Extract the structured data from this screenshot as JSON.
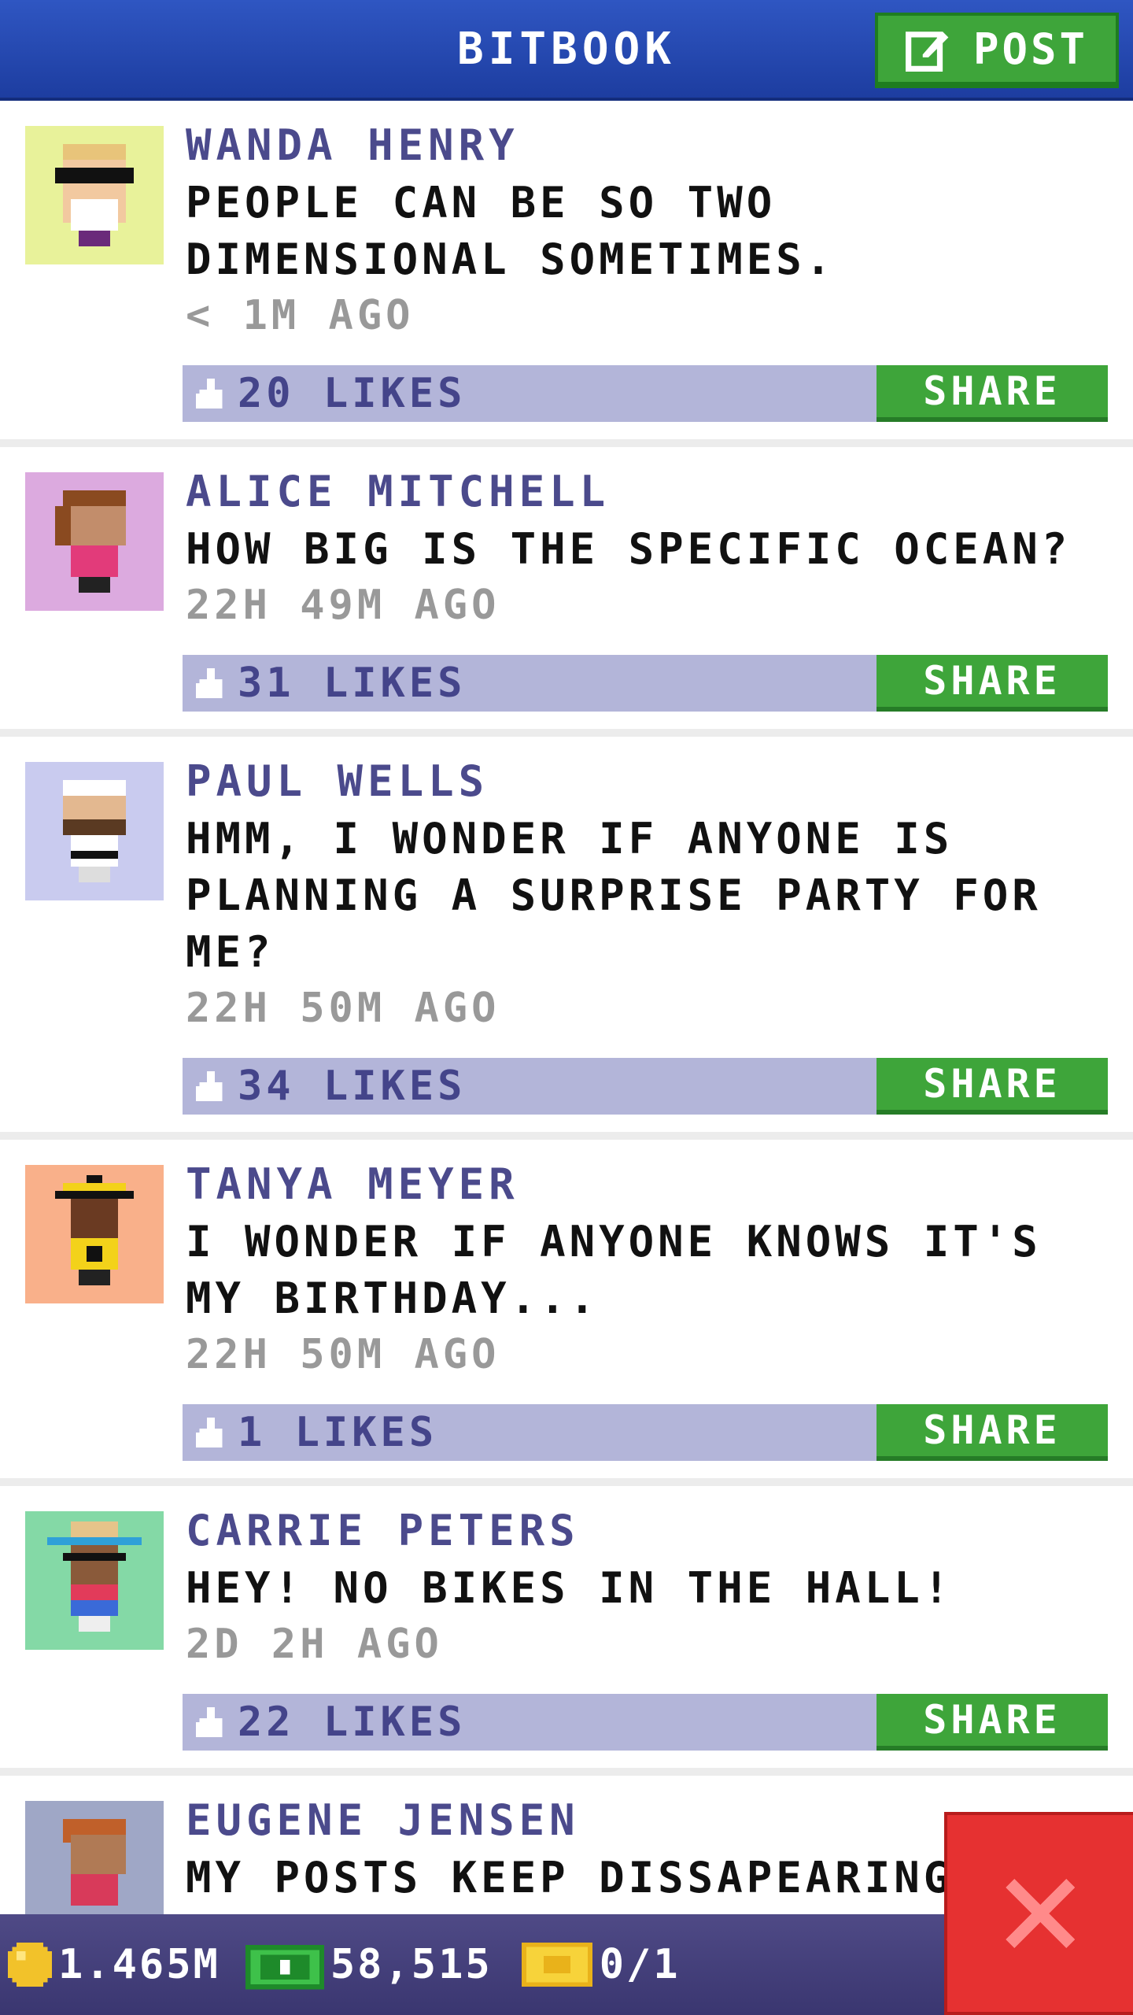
{
  "header": {
    "title": "BITBOOK",
    "post_label": "POST",
    "accent": "#2f56c2",
    "post_color": "#3ea53a"
  },
  "posts": [
    {
      "name": "WANDA HENRY",
      "message": "PEOPLE CAN BE SO TWO DIMENSIONAL SOMETIMES.",
      "time": "< 1M AGO",
      "likes": "20 LIKES",
      "share": "SHARE",
      "avatar_bg": "#e8f29a"
    },
    {
      "name": "ALICE MITCHELL",
      "message": "HOW BIG IS THE SPECIFIC OCEAN?",
      "time": "22H 49M AGO",
      "likes": "31 LIKES",
      "share": "SHARE",
      "avatar_bg": "#dcaadf"
    },
    {
      "name": "PAUL WELLS",
      "message": "HMM, I WONDER IF ANYONE IS PLANNING A SURPRISE PARTY FOR ME?",
      "time": "22H 50M AGO",
      "likes": "34 LIKES",
      "share": "SHARE",
      "avatar_bg": "#c9cbef"
    },
    {
      "name": "TANYA MEYER",
      "message": "I WONDER IF ANYONE KNOWS IT'S MY BIRTHDAY...",
      "time": "22H 50M AGO",
      "likes": "1 LIKES",
      "share": "SHARE",
      "avatar_bg": "#f9b08a"
    },
    {
      "name": "CARRIE PETERS",
      "message": "HEY! NO BIKES IN THE HALL!",
      "time": "2D 2H AGO",
      "likes": "22 LIKES",
      "share": "SHARE",
      "avatar_bg": "#84d9a6"
    },
    {
      "name": "EUGENE JENSEN",
      "message": "MY POSTS KEEP DISSAPEARING.",
      "time": "",
      "likes": "",
      "share": "",
      "avatar_bg": "#9fa7c6"
    }
  ],
  "footer": {
    "coins": "1.465M",
    "bux": "58,515",
    "tickets": "0/1"
  }
}
